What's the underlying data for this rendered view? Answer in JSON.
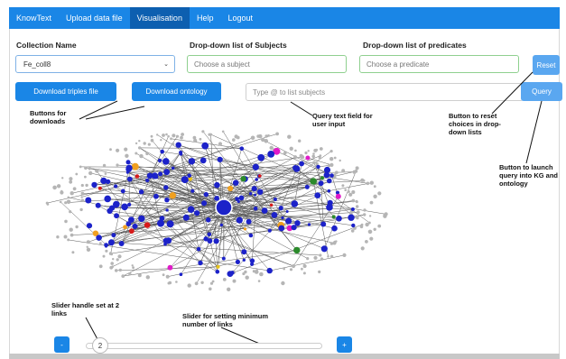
{
  "nav": {
    "items": [
      {
        "label": "KnowText"
      },
      {
        "label": "Upload data file"
      },
      {
        "label": "Visualisation"
      },
      {
        "label": "Help"
      },
      {
        "label": "Logout"
      }
    ]
  },
  "form": {
    "collection_label": "Collection Name",
    "collection_value": "Fe_coll8",
    "subjects_label": "Drop-down list of Subjects",
    "subject_placeholder": "Choose a subject",
    "predicates_label": "Drop-down list of predicates",
    "predicate_placeholder": "Choose a predicate",
    "reset_label": "Reset",
    "download_triples_label": "Download triples file",
    "download_ontology_label": "Download ontology",
    "query_placeholder": "Type @ to list subjects",
    "query_label": "Query"
  },
  "annotations": {
    "buttons_downloads": "Buttons for downloads",
    "query_text_field": "Query text field for user input",
    "reset_button": "Button to reset choices in drop-down lists",
    "query_button": "Button to launch query into KG and ontology",
    "slider_handle": "Slider handle set at 2 links",
    "slider_setting": "Slider for setting minimum number of links"
  },
  "slider": {
    "min_label": "-",
    "max_label": "+",
    "value": "2"
  },
  "colors": {
    "primary": "#1a86e6",
    "node": "#1c22c9",
    "accent_nodes": [
      "#1c22c9",
      "#2b8a2b",
      "#e6c21a",
      "#d61a1a",
      "#e01ac8",
      "#f0a020"
    ]
  }
}
